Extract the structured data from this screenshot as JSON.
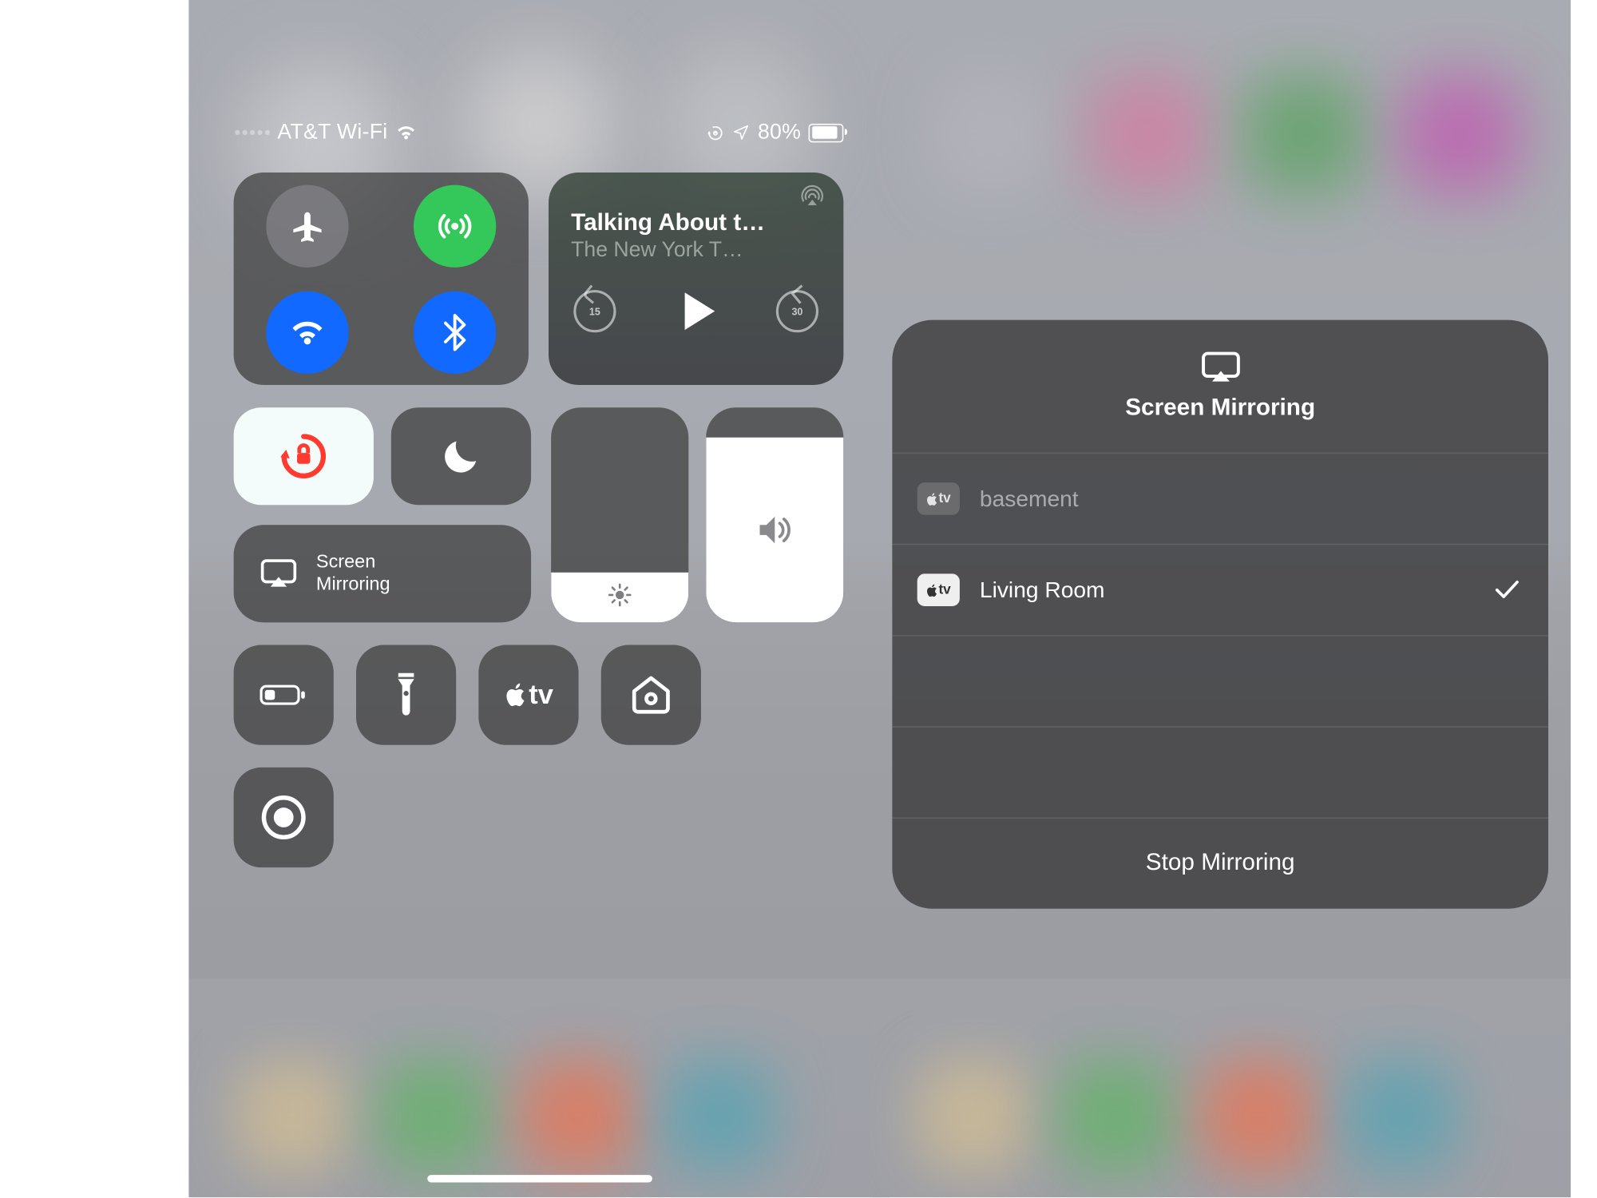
{
  "statusbar": {
    "cell_dots": 5,
    "cell_active": 0,
    "carrier": "AT&T Wi-Fi",
    "battery_pct": "80%",
    "battery_fill": 0.8
  },
  "media": {
    "title": "Talking About t…",
    "subtitle": "The New York T…",
    "back_seconds": "15",
    "fwd_seconds": "30"
  },
  "screen_mirroring_label": "Screen\nMirroring",
  "brightness_level": 0.23,
  "volume_level": 0.86,
  "popup": {
    "title": "Screen Mirroring",
    "stop_label": "Stop Mirroring",
    "devices": [
      {
        "name": "basement",
        "selected": false,
        "badge_fg": "#e4e4e6",
        "badge_bg": "#6b6b6e"
      },
      {
        "name": "Living Room",
        "selected": true,
        "badge_fg": "#333",
        "badge_bg": "#efeff0"
      }
    ]
  },
  "colors": {
    "tile": "#4e4e52",
    "green": "#34c759",
    "blue": "#1169ff",
    "rotlock_accent": "#ff3b30",
    "rotlock_bg": "#f4fbfb"
  }
}
